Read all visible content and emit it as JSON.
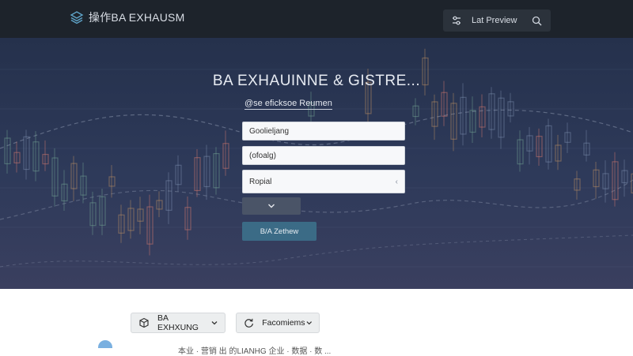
{
  "app": {
    "brand_name": "操作BA EXHAUSM",
    "preview_label": "Lat Preview"
  },
  "hero": {
    "title": "BA EXHAUINNE & GISTRE...",
    "subtitle": "@se eficksoe Reumen"
  },
  "form": {
    "field1_value": "Goolieljang",
    "field2_value": "(ofoalg)",
    "field3_value": "Ropial",
    "submit_label": "B/A Zethew"
  },
  "bottom": {
    "chip1_label": "BA EXHXUNG",
    "chip2_label": "Facomiems",
    "row_text": "本业 · 营销 出 的LIANHG 企业 · 数据 · 数 ..."
  },
  "colors": {
    "topbar": "#1d232b",
    "accent": "#3b6b86"
  }
}
